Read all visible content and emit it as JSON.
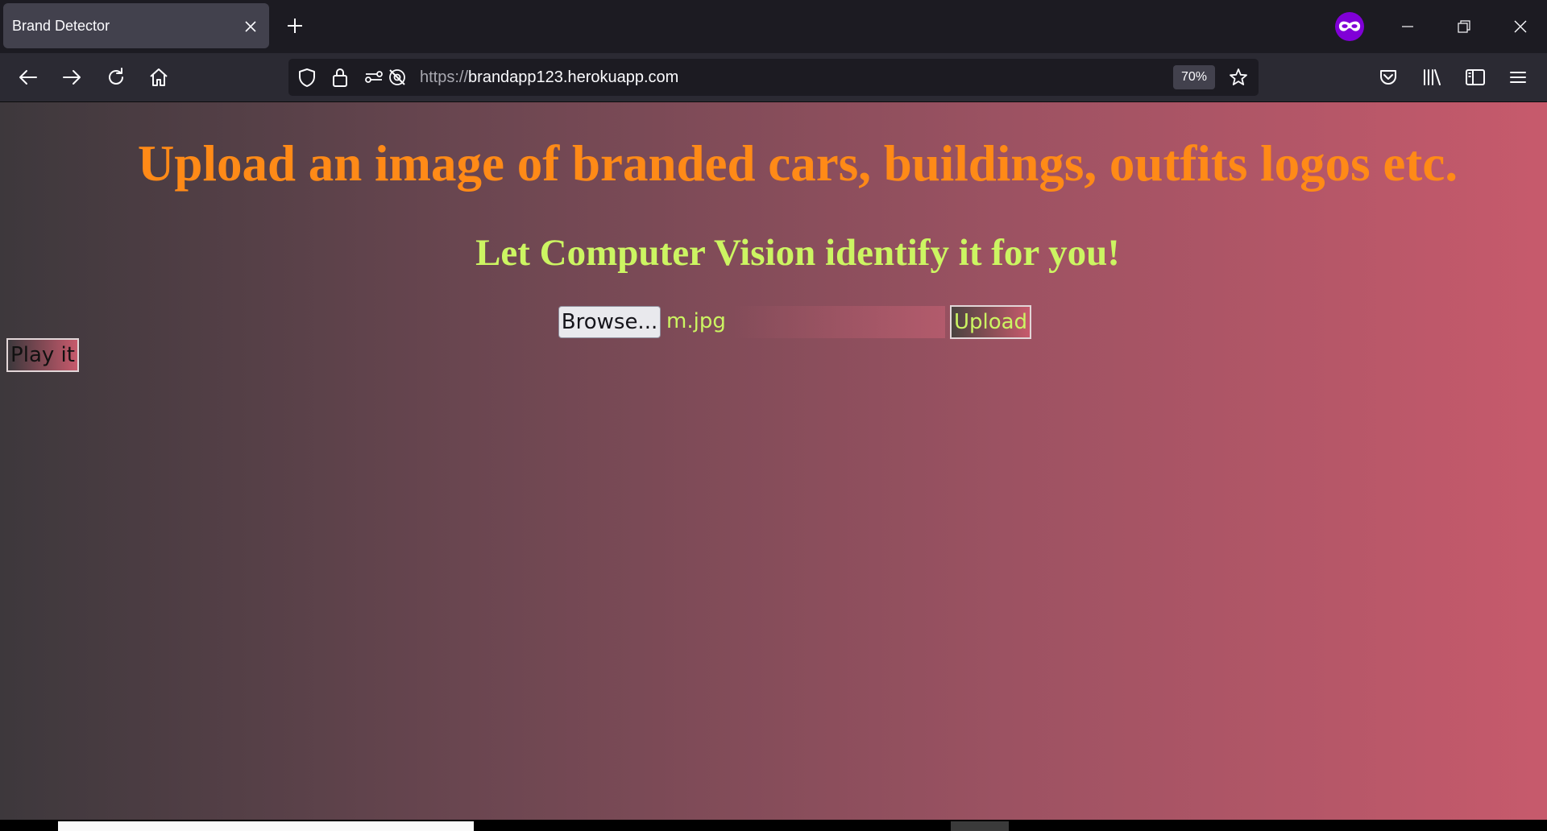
{
  "browser": {
    "tab_title": "Brand Detector",
    "url_protocol": "https://",
    "url_host": "brandapp123.herokuapp.com",
    "zoom": "70%"
  },
  "page": {
    "headline": "Upload an image of branded cars, buildings, outfits logos etc.",
    "subheadline": "Let Computer Vision identify it for you!",
    "browse_label": "Browse...",
    "file_name": "m.jpg",
    "upload_label": "Upload",
    "play_label": "Play it"
  },
  "colors": {
    "headline": "#ff8a17",
    "subheadline": "#ccf562",
    "private_browsing": "#8000d7"
  },
  "icons": {
    "back": "back-arrow-icon",
    "forward": "forward-arrow-icon",
    "reload": "reload-icon",
    "home": "home-icon",
    "tracking": "shield-icon",
    "lock": "lock-icon",
    "permissions": "permissions-icon",
    "camera_blocked": "camera-blocked-icon",
    "bookmark": "star-icon",
    "pocket": "pocket-icon",
    "library": "library-icon",
    "sidebar": "sidebar-icon",
    "menu": "hamburger-menu-icon",
    "private": "private-browsing-mask-icon"
  }
}
